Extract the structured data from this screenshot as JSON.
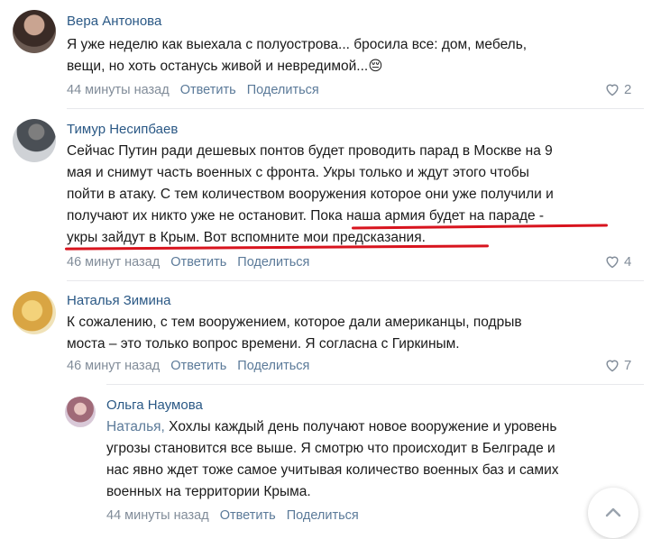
{
  "comments": [
    {
      "author": "Вера Антонова",
      "lines": [
        "Я уже неделю как выехала с полуострова... бросила все: дом, мебель,",
        "вещи, но хоть останусь живой и невредимой...😔"
      ],
      "time": "44 минуты назад",
      "reply": "Ответить",
      "share": "Поделиться",
      "likes": "2"
    },
    {
      "author": "Тимур Несипбаев",
      "lines": [
        "Сейчас Путин ради дешевых понтов будет проводить парад в Москве на 9",
        "мая и снимут часть военных с фронта. Укры только и ждут этого чтобы",
        "пойти в атаку. С тем количеством вооружения которое они уже получили и",
        "получают их никто уже не остановит. Пока наша армия будет на параде -",
        "укры зайдут в Крым. Вот вспомните мои предсказания."
      ],
      "time": "46 минут назад",
      "reply": "Ответить",
      "share": "Поделиться",
      "likes": "4"
    },
    {
      "author": "Наталья Зимина",
      "lines": [
        "К сожалению, с тем вооружением, которое дали американцы, подрыв",
        "моста – это только вопрос времени. Я согласна с Гиркиным."
      ],
      "time": "46 минут назад",
      "reply": "Ответить",
      "share": "Поделиться",
      "likes": "7"
    },
    {
      "author": "Ольга Наумова",
      "reply_to": "Наталья,",
      "lines": [
        " Хохлы каждый день получают новое вооружение и уровень",
        "угрозы становится все выше. Я смотрю что происходит в Белграде и",
        "нас явно ждет тоже самое учитывая количество военных баз и самих",
        "военных на территории Крыма."
      ],
      "time": "44 минуты назад",
      "reply": "Ответить",
      "share": "Поделиться"
    }
  ],
  "colors": {
    "author": "#2a5885",
    "meta": "#818c99",
    "underline": "#d8141e"
  },
  "icons": {
    "like": "heart-icon",
    "scroll": "chevron-up-icon"
  }
}
